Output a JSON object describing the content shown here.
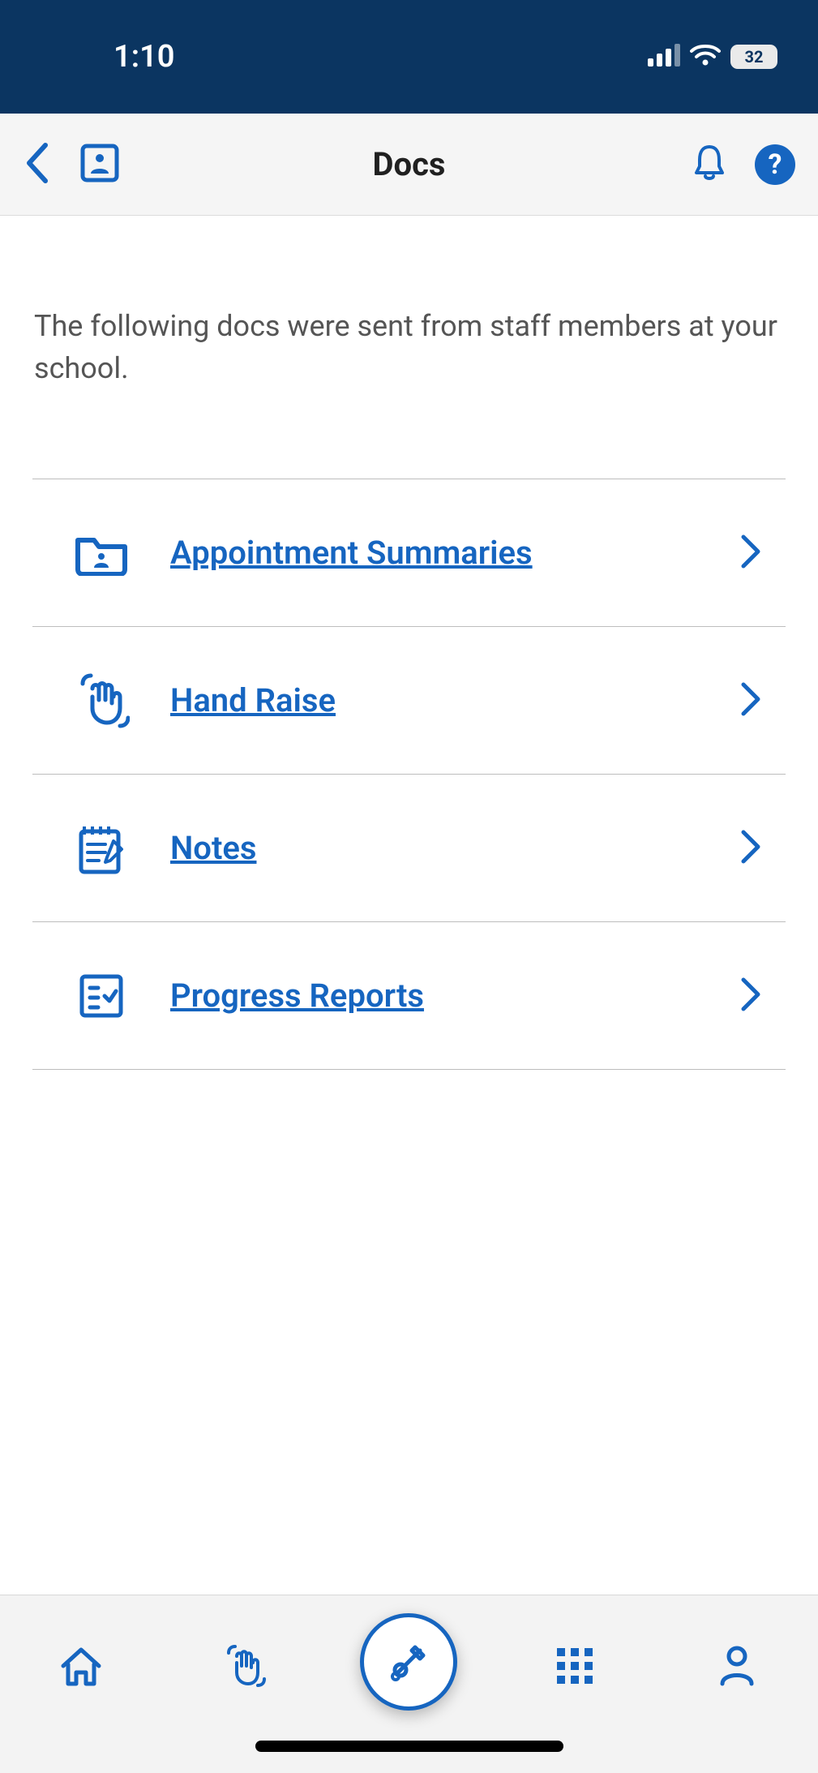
{
  "status": {
    "time": "1:10",
    "battery": "32"
  },
  "header": {
    "title": "Docs"
  },
  "intro": {
    "text": "The following docs were sent from staff members at your school."
  },
  "docs": [
    {
      "label": "Appointment Summaries"
    },
    {
      "label": "Hand Raise"
    },
    {
      "label": "Notes"
    },
    {
      "label": "Progress Reports"
    }
  ]
}
